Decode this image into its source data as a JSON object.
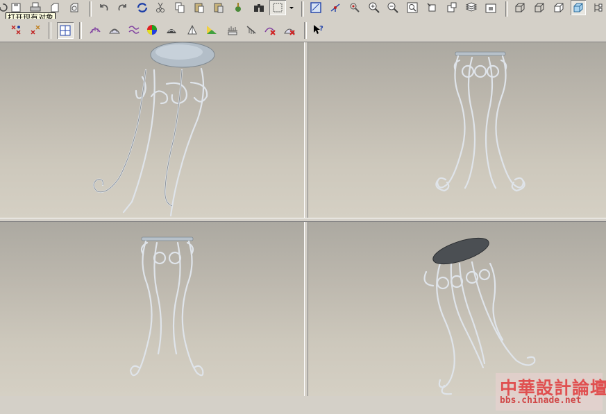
{
  "toolbar": {
    "tooltip_text": "打开现有对象",
    "row1_icons": [
      "regenerate-icon",
      "save-icon",
      "print-icon",
      "save-copy-icon",
      "backup-icon",
      "undo-icon",
      "redo-icon",
      "refresh-icon",
      "cut-icon",
      "copy-icon",
      "paste-icon",
      "paste-special-icon",
      "model-tree-icon",
      "search-binoculars-icon",
      "select-box-icon",
      "dropdown-arrow-icon",
      "datum-plane-display-icon",
      "datum-axis-display-icon",
      "point-display-icon",
      "zoom-in-icon",
      "zoom-out-icon",
      "zoom-fit-icon",
      "spin-center-icon",
      "orient-icon",
      "layers-icon",
      "view-manager-icon",
      "wireframe-icon",
      "hidden-line-icon",
      "no-hidden-icon",
      "shading-icon",
      "more-icon"
    ],
    "row2_icons": [
      "datum-points-icon",
      "datum-planes-icon",
      "datum-axes-icon",
      "sketch-view-icon",
      "curvature-icon",
      "reflection-icon",
      "section-icon",
      "draft-icon",
      "color-shade-icon",
      "surface-analysis-icon",
      "dihedral-icon",
      "offset-analysis-icon",
      "deviation-icon",
      "delete-analysis-icon",
      "hide-analysis-icon",
      "context-help-icon"
    ]
  },
  "viewports": [
    {
      "name": "top-left",
      "view": "iso-view-1"
    },
    {
      "name": "top-right",
      "view": "front-view"
    },
    {
      "name": "bottom-left",
      "view": "side-view"
    },
    {
      "name": "bottom-right",
      "view": "iso-view-2"
    }
  ],
  "watermark": {
    "title": "中華設計論壇",
    "url": "bbs.chinade.net"
  },
  "colors": {
    "window_bg": "#d4d0c8",
    "viewport_top": "#aca9a1",
    "viewport_bottom": "#d5d0c4",
    "wire": "#dfe4ea",
    "seat_dark": "#4b4f53",
    "watermark_red": "#e05050"
  }
}
